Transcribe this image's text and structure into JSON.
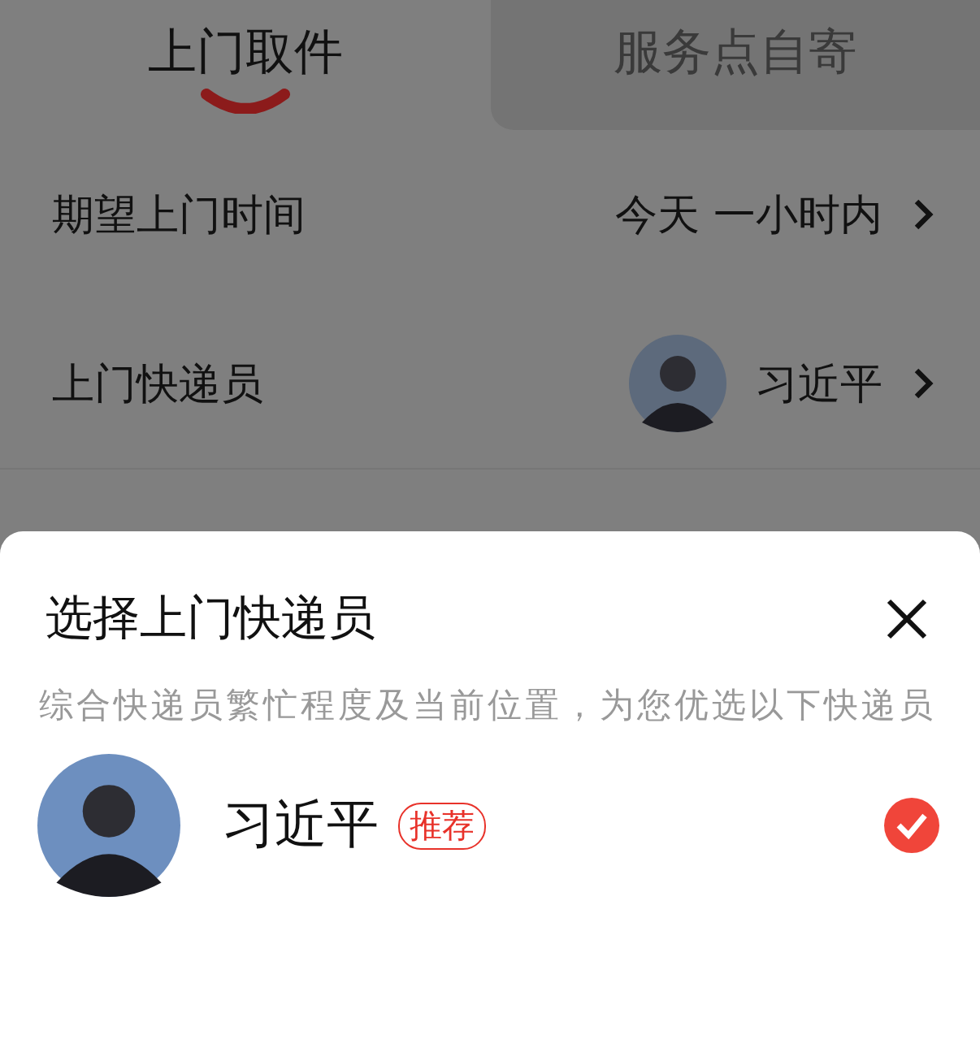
{
  "tabs": [
    {
      "label": "上门取件",
      "selected": true
    },
    {
      "label": "服务点自寄",
      "selected": false
    }
  ],
  "rows": [
    {
      "kind": "text",
      "label": "期望上门时间",
      "value": "今天 一小时内"
    },
    {
      "kind": "courier",
      "label": "上门快递员",
      "value": "习近平"
    }
  ],
  "sheet": {
    "title": "选择上门快递员",
    "description": "综合快递员繁忙程度及当前位置，为您优选以下快递员",
    "couriers": [
      {
        "name": "习近平",
        "badge": "推荐",
        "selected": true
      }
    ]
  }
}
